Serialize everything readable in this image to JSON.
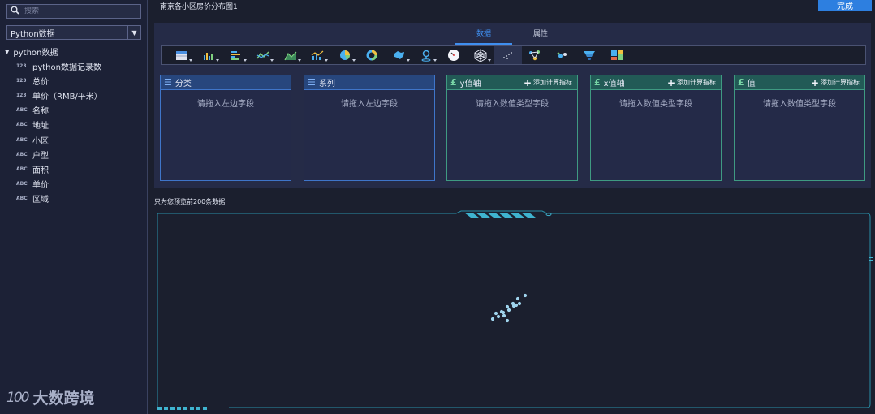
{
  "search": {
    "placeholder": "搜索"
  },
  "dataset": {
    "selected": "Python数据"
  },
  "tree": {
    "root": "python数据",
    "fields": [
      {
        "type": "123",
        "name": "python数据记录数"
      },
      {
        "type": "123",
        "name": "总价"
      },
      {
        "type": "123",
        "name": "单价（RMB/平米）"
      },
      {
        "type": "ABC",
        "name": "名称"
      },
      {
        "type": "ABC",
        "name": "地址"
      },
      {
        "type": "ABC",
        "name": "小区"
      },
      {
        "type": "ABC",
        "name": "户型"
      },
      {
        "type": "ABC",
        "name": "面积"
      },
      {
        "type": "ABC",
        "name": "单价"
      },
      {
        "type": "ABC",
        "name": "区域"
      }
    ]
  },
  "logo": {
    "mark": "100",
    "text": "大数跨境"
  },
  "header": {
    "title": "南京各小区房价分布图1",
    "done_label": "完成"
  },
  "tabs": [
    {
      "label": "数据",
      "active": true
    },
    {
      "label": "属性",
      "active": false
    }
  ],
  "toolbar": {
    "icons": [
      "table-icon",
      "bar-chart-icon",
      "horizontal-bar-icon",
      "line-chart-icon",
      "area-chart-icon",
      "combo-chart-icon",
      "pie-chart-icon",
      "donut-chart-icon",
      "map-icon",
      "location-map-icon",
      "gauge-icon",
      "radar-chart-icon",
      "scatter-chart-icon",
      "relation-graph-icon",
      "bubble-chart-icon",
      "funnel-chart-icon",
      "treemap-icon"
    ]
  },
  "dropzones": [
    {
      "label": "分类",
      "kind": "dimension",
      "hint": "请拖入左边字段",
      "add_label": ""
    },
    {
      "label": "系列",
      "kind": "dimension",
      "hint": "请拖入左边字段",
      "add_label": ""
    },
    {
      "label": "y值轴",
      "kind": "measure",
      "hint": "请拖入数值类型字段",
      "add_label": "添加计算指标"
    },
    {
      "label": "x值轴",
      "kind": "measure",
      "hint": "请拖入数值类型字段",
      "add_label": "添加计算指标"
    },
    {
      "label": "值",
      "kind": "measure",
      "hint": "请拖入数值类型字段",
      "add_label": "添加计算指标"
    }
  ],
  "preview": {
    "note": "只为您预览前200条数据"
  },
  "colors": {
    "accent": "#2d7fe0",
    "dimension": "#3f75c9",
    "measure": "#3f9a82",
    "frame": "#2a8fa8"
  }
}
